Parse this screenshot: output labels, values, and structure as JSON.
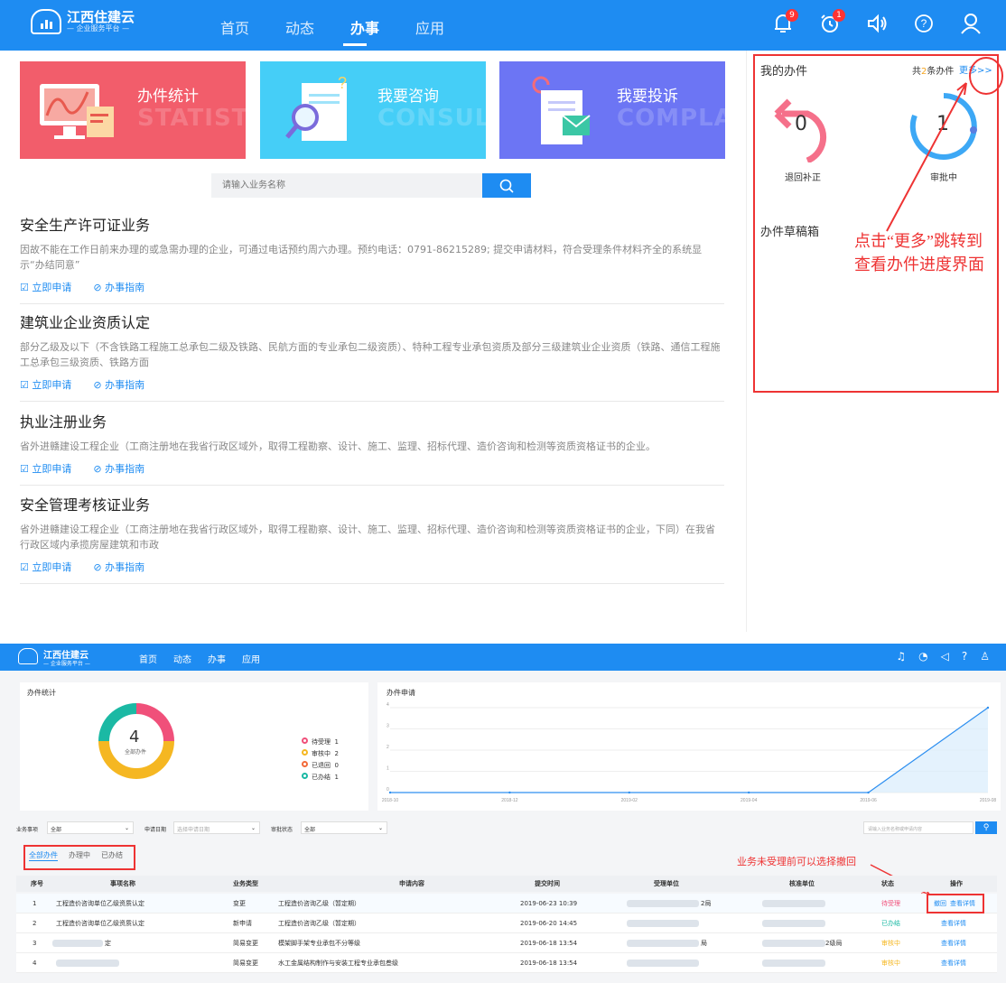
{
  "top": {
    "logo_title": "江西住建云",
    "logo_sub": "— 企业服务平台 —",
    "nav": [
      "首页",
      "动态",
      "办事",
      "应用"
    ],
    "badges": [
      "9",
      "1"
    ]
  },
  "cards": [
    {
      "title": "办件统计",
      "bg": "STATISTIC",
      "color": "#f25d6b"
    },
    {
      "title": "我要咨询",
      "bg": "CONSULT",
      "color": "#45cef7"
    },
    {
      "title": "我要投诉",
      "bg": "COMPLAIN",
      "color": "#6c75f4"
    }
  ],
  "search": {
    "placeholder": "请输入业务名称"
  },
  "sections": [
    {
      "title": "安全生产许可证业务",
      "desc": "因故不能在工作日前来办理的或急需办理的企业，可通过电话预约周六办理。预约电话：0791-86215289; 提交申请材料，符合受理条件材料齐全的系统显示“办结同意”"
    },
    {
      "title": "建筑业企业资质认定",
      "desc": "部分乙级及以下（不含铁路工程施工总承包二级及铁路、民航方面的专业承包二级资质）、特种工程专业承包资质及部分三级建筑业企业资质（铁路、通信工程施工总承包三级资质、铁路方面"
    },
    {
      "title": "执业注册业务",
      "desc": "省外进赣建设工程企业（工商注册地在我省行政区域外，取得工程勘察、设计、施工、监理、招标代理、造价咨询和检测等资质资格证书的企业。"
    },
    {
      "title": "安全管理考核证业务",
      "desc": "省外进赣建设工程企业（工商注册地在我省行政区域外，取得工程勘察、设计、施工、监理、招标代理、造价咨询和检测等资质资格证书的企业，下同）在我省行政区域内承揽房屋建筑和市政"
    }
  ],
  "actions": {
    "apply": "立即申请",
    "guide": "办事指南"
  },
  "panel": {
    "title": "我的办件",
    "count_pre": "共",
    "count_num": "2",
    "count_post": "条办件",
    "more": "更多>>",
    "returned_num": "0",
    "returned_label": "退回补正",
    "review_num": "1",
    "review_label": "审批中",
    "drafts": "办件草稿箱"
  },
  "annotation1": "点击“更多”跳转到查看办件进度界面",
  "bottom": {
    "nav": [
      "首页",
      "动态",
      "办事",
      "应用"
    ],
    "stats_title": "办件统计",
    "donut_num": "4",
    "donut_label": "全部办件",
    "legend": [
      {
        "label": "待受理",
        "value": "1",
        "color": "#f0507a"
      },
      {
        "label": "审核中",
        "value": "2",
        "color": "#f5b722"
      },
      {
        "label": "已退回",
        "value": "0",
        "color": "#f26b3a"
      },
      {
        "label": "已办结",
        "value": "1",
        "color": "#1bb9a4"
      }
    ],
    "apply_title": "办件申请",
    "filters": {
      "type_label": "业务事项",
      "type_val": "全部",
      "date_label": "申请日期",
      "date_ph": "选择申请日期",
      "status_label": "审批状态",
      "status_val": "全部",
      "search_ph": "请输入业务名称或申请内容"
    },
    "tabs": [
      "全部办件",
      "办理中",
      "已办结"
    ],
    "annotation2": "业务未受理前可以选择撤回",
    "headers": [
      "序号",
      "事项名称",
      "业务类型",
      "申请内容",
      "提交时间",
      "受理单位",
      "核准单位",
      "状态",
      "操作"
    ],
    "rows": [
      {
        "no": "1",
        "name": "工程造价咨询单位乙级资质认定",
        "type": "变更",
        "content": "工程造价咨询乙级（暂定期）",
        "time": "2019-06-23 10:39",
        "recv_suffix": "2局",
        "appr_suffix": "",
        "status": "待受理",
        "status_color": "#f0507a",
        "op1": "撤回",
        "op2": "查看详情"
      },
      {
        "no": "2",
        "name": "工程造价咨询单位乙级资质认定",
        "type": "新申请",
        "content": "工程造价咨询乙级（暂定期）",
        "time": "2019-06-20 14:45",
        "recv_suffix": "",
        "appr_suffix": "",
        "status": "已办结",
        "status_color": "#1bb9a4",
        "op1": "",
        "op2": "查看详情"
      },
      {
        "no": "3",
        "name": "定",
        "type": "简易变更",
        "content": "模架脚手架专业承包不分等级",
        "time": "2019-06-18 13:54",
        "recv_suffix": "局",
        "appr_suffix": "2级局",
        "status": "审核中",
        "status_color": "#f5b722",
        "op1": "",
        "op2": "查看详情"
      },
      {
        "no": "4",
        "name": "",
        "type": "简易变更",
        "content": "水工金属结构制作与安装工程专业承包叁级",
        "time": "2019-06-18 13:54",
        "recv_suffix": "",
        "appr_suffix": "",
        "status": "审核中",
        "status_color": "#f5b722",
        "op1": "",
        "op2": "查看详情"
      }
    ],
    "chart_data": {
      "type": "area",
      "x_ticks": [
        "2018-10",
        "2018-12",
        "2019-02",
        "2019-04",
        "2019-06",
        "2019-08"
      ],
      "y_ticks": [
        "0",
        "1",
        "2",
        "3",
        "4"
      ],
      "ylim": [
        0,
        4
      ],
      "x": [
        "2018-10",
        "2018-12",
        "2019-02",
        "2019-04",
        "2019-06",
        "2019-08"
      ],
      "values": [
        0,
        0,
        0,
        0,
        0,
        4
      ]
    }
  }
}
